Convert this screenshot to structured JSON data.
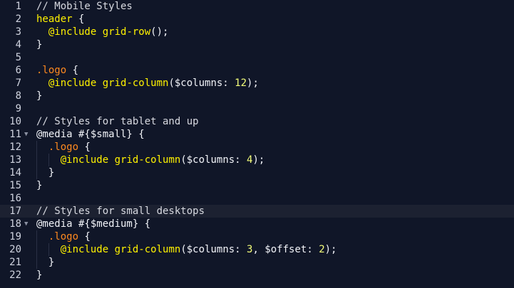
{
  "editor": {
    "lines": [
      {
        "num": "1",
        "fold": "",
        "tokens": [
          {
            "t": "// Mobile Styles",
            "k": "comment"
          }
        ]
      },
      {
        "num": "2",
        "fold": "",
        "tokens": [
          {
            "t": "header",
            "k": "selector"
          },
          {
            "t": " {",
            "k": "plain"
          }
        ]
      },
      {
        "num": "3",
        "fold": "",
        "tokens": [
          {
            "t": "  ",
            "k": "plain"
          },
          {
            "t": "@include",
            "k": "atrule"
          },
          {
            "t": " ",
            "k": "plain"
          },
          {
            "t": "grid-row",
            "k": "func"
          },
          {
            "t": "();",
            "k": "plain"
          }
        ]
      },
      {
        "num": "4",
        "fold": "",
        "tokens": [
          {
            "t": "}",
            "k": "plain"
          }
        ]
      },
      {
        "num": "5",
        "fold": "",
        "tokens": []
      },
      {
        "num": "6",
        "fold": "",
        "tokens": [
          {
            "t": ".logo",
            "k": "class"
          },
          {
            "t": " {",
            "k": "plain"
          }
        ]
      },
      {
        "num": "7",
        "fold": "",
        "tokens": [
          {
            "t": "  ",
            "k": "plain"
          },
          {
            "t": "@include",
            "k": "atrule"
          },
          {
            "t": " ",
            "k": "plain"
          },
          {
            "t": "grid-column",
            "k": "func"
          },
          {
            "t": "($columns: ",
            "k": "plain"
          },
          {
            "t": "12",
            "k": "number"
          },
          {
            "t": ");",
            "k": "plain"
          }
        ]
      },
      {
        "num": "8",
        "fold": "",
        "tokens": [
          {
            "t": "}",
            "k": "plain"
          }
        ]
      },
      {
        "num": "9",
        "fold": "",
        "tokens": []
      },
      {
        "num": "10",
        "fold": "",
        "tokens": [
          {
            "t": "// Styles for tablet and up",
            "k": "comment"
          }
        ]
      },
      {
        "num": "11",
        "fold": "▼",
        "tokens": [
          {
            "t": "@media #{$small} {",
            "k": "plain"
          }
        ]
      },
      {
        "num": "12",
        "fold": "",
        "tokens": [
          {
            "t": "  ",
            "k": "plain"
          },
          {
            "t": ".logo",
            "k": "class"
          },
          {
            "t": " {",
            "k": "plain"
          }
        ]
      },
      {
        "num": "13",
        "fold": "",
        "tokens": [
          {
            "t": "    ",
            "k": "plain"
          },
          {
            "t": "@include",
            "k": "atrule"
          },
          {
            "t": " ",
            "k": "plain"
          },
          {
            "t": "grid-column",
            "k": "func"
          },
          {
            "t": "($columns: ",
            "k": "plain"
          },
          {
            "t": "4",
            "k": "number"
          },
          {
            "t": ");",
            "k": "plain"
          }
        ]
      },
      {
        "num": "14",
        "fold": "",
        "tokens": [
          {
            "t": "  }",
            "k": "plain"
          }
        ]
      },
      {
        "num": "15",
        "fold": "",
        "tokens": [
          {
            "t": "}",
            "k": "plain"
          }
        ]
      },
      {
        "num": "16",
        "fold": "",
        "tokens": []
      },
      {
        "num": "17",
        "fold": "",
        "active": true,
        "tokens": [
          {
            "t": "// Styles for small desktops",
            "k": "comment"
          }
        ]
      },
      {
        "num": "18",
        "fold": "▼",
        "tokens": [
          {
            "t": "@media #{$medium} {",
            "k": "plain"
          }
        ]
      },
      {
        "num": "19",
        "fold": "",
        "tokens": [
          {
            "t": "  ",
            "k": "plain"
          },
          {
            "t": ".logo",
            "k": "class"
          },
          {
            "t": " {",
            "k": "plain"
          }
        ]
      },
      {
        "num": "20",
        "fold": "",
        "tokens": [
          {
            "t": "    ",
            "k": "plain"
          },
          {
            "t": "@include",
            "k": "atrule"
          },
          {
            "t": " ",
            "k": "plain"
          },
          {
            "t": "grid-column",
            "k": "func"
          },
          {
            "t": "($columns: ",
            "k": "plain"
          },
          {
            "t": "3",
            "k": "number"
          },
          {
            "t": ", $offset: ",
            "k": "plain"
          },
          {
            "t": "2",
            "k": "number"
          },
          {
            "t": ");",
            "k": "plain"
          }
        ]
      },
      {
        "num": "21",
        "fold": "",
        "tokens": [
          {
            "t": "  }",
            "k": "plain"
          }
        ]
      },
      {
        "num": "22",
        "fold": "",
        "tokens": [
          {
            "t": "}",
            "k": "plain"
          }
        ]
      }
    ]
  },
  "colors": {
    "background": "#101628",
    "active_line": "#1c2131",
    "comment": "#d7d9e0",
    "keyword_yellow": "#fff200",
    "class_orange": "#ff8a1f",
    "number": "#f5ff7a"
  }
}
